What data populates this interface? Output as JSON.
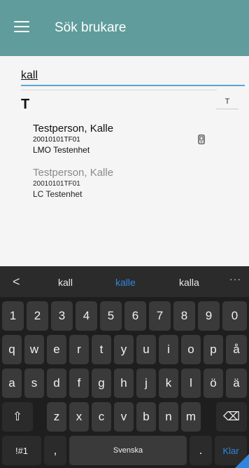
{
  "appbar": {
    "title": "Sök brukare",
    "menu_icon": "hamburger-menu-icon",
    "bg_color": "#5f9c9b"
  },
  "search": {
    "value": "kall"
  },
  "section": {
    "letter": "T",
    "index_letter": "T"
  },
  "results": [
    {
      "name": "Testperson, Kalle",
      "id": "20010101TF01",
      "unit": "LMO Testenhet",
      "icon": "phone-icon"
    },
    {
      "name": "Testperson, Kalle",
      "id": "20010101TF01",
      "unit": "LC Testenhet"
    }
  ],
  "keyboard": {
    "back": "<",
    "suggestions": [
      "kall",
      "kalle",
      "kalla"
    ],
    "active_suggestion": "kalle",
    "more": "···",
    "row_numbers": [
      "1",
      "2",
      "3",
      "4",
      "5",
      "6",
      "7",
      "8",
      "9",
      "0"
    ],
    "row1": [
      "q",
      "w",
      "e",
      "r",
      "t",
      "y",
      "u",
      "i",
      "o",
      "p",
      "å"
    ],
    "row2": [
      "a",
      "s",
      "d",
      "f",
      "g",
      "h",
      "j",
      "k",
      "l",
      "ö",
      "ä"
    ],
    "row3": [
      "z",
      "x",
      "c",
      "v",
      "b",
      "n",
      "m"
    ],
    "shift": "⇧",
    "backspace": "⌫",
    "symbols": "!#1",
    "comma": ",",
    "space": "Svenska",
    "period": ".",
    "enter": "Klar",
    "accent_color": "#2f86e0"
  }
}
